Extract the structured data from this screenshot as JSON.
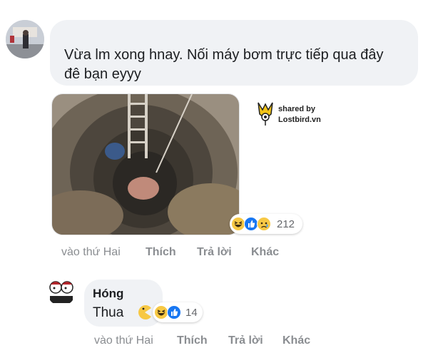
{
  "comment1": {
    "text": "Vừa lm xong hnay. Nối máy bơm trực tiếp qua đây đê bạn eyyy",
    "reactions": {
      "icons": [
        "haha-icon",
        "like-icon",
        "sad-icon"
      ],
      "count": "212"
    },
    "actions": {
      "time": "vào thứ Hai",
      "like": "Thích",
      "reply": "Trả lời",
      "more": "Khác"
    }
  },
  "watermark": {
    "line1": "shared by",
    "line2": "Lostbird.vn"
  },
  "comment2": {
    "author": "Hóng",
    "text": "Thua",
    "reactions": {
      "icons": [
        "haha-icon",
        "like-icon"
      ],
      "count": "14"
    },
    "actions": {
      "time": "vào thứ Hai",
      "like": "Thích",
      "reply": "Trả lời",
      "more": "Khác"
    }
  },
  "colors": {
    "bubble": "#f0f2f5",
    "like_blue": "#1877f2",
    "haha_yellow": "#f7c844",
    "meta_gray": "#8a8d91"
  }
}
